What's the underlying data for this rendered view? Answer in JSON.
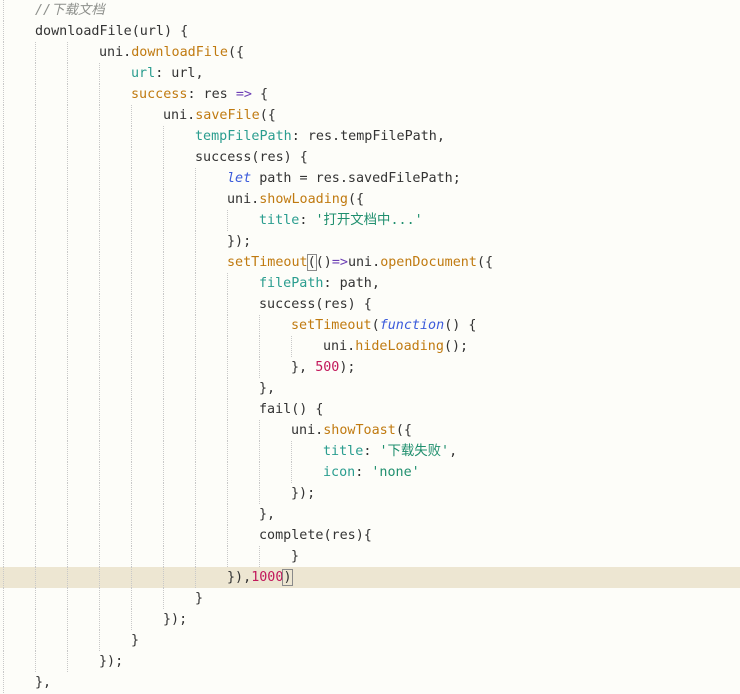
{
  "editor": {
    "current_line_index": 27,
    "lines": [
      {
        "indent": 1,
        "tokens": [
          {
            "t": "//下载文档",
            "c": "comment"
          }
        ]
      },
      {
        "indent": 1,
        "tokens": [
          {
            "t": "downloadFile(url) {",
            "c": ""
          }
        ]
      },
      {
        "indent": 3,
        "tokens": [
          {
            "t": "uni.",
            "c": ""
          },
          {
            "t": "downloadFile",
            "c": "fn"
          },
          {
            "t": "({",
            "c": ""
          }
        ]
      },
      {
        "indent": 4,
        "tokens": [
          {
            "t": "url",
            "c": "prop"
          },
          {
            "t": ": url,",
            "c": ""
          }
        ]
      },
      {
        "indent": 4,
        "tokens": [
          {
            "t": "success",
            "c": "fn"
          },
          {
            "t": ": res ",
            "c": ""
          },
          {
            "t": "=>",
            "c": "op"
          },
          {
            "t": " {",
            "c": ""
          }
        ]
      },
      {
        "indent": 5,
        "tokens": [
          {
            "t": "uni.",
            "c": ""
          },
          {
            "t": "saveFile",
            "c": "fn"
          },
          {
            "t": "({",
            "c": ""
          }
        ]
      },
      {
        "indent": 6,
        "tokens": [
          {
            "t": "tempFilePath",
            "c": "prop"
          },
          {
            "t": ": res.tempFilePath,",
            "c": ""
          }
        ]
      },
      {
        "indent": 6,
        "tokens": [
          {
            "t": "success(res) {",
            "c": ""
          }
        ]
      },
      {
        "indent": 7,
        "tokens": [
          {
            "t": "let",
            "c": "kw"
          },
          {
            "t": " path = res.savedFilePath;",
            "c": ""
          }
        ]
      },
      {
        "indent": 7,
        "tokens": [
          {
            "t": "uni.",
            "c": ""
          },
          {
            "t": "showLoading",
            "c": "fn"
          },
          {
            "t": "({",
            "c": ""
          }
        ]
      },
      {
        "indent": 8,
        "tokens": [
          {
            "t": "title",
            "c": "prop"
          },
          {
            "t": ": ",
            "c": ""
          },
          {
            "t": "'打开文档中...'",
            "c": "str"
          }
        ]
      },
      {
        "indent": 7,
        "tokens": [
          {
            "t": "});",
            "c": ""
          }
        ]
      },
      {
        "indent": 7,
        "tokens": [
          {
            "t": "setTimeout",
            "c": "fn"
          },
          {
            "t": "(",
            "c": "bracket-match"
          },
          {
            "t": "()",
            "c": ""
          },
          {
            "t": "=>",
            "c": "op"
          },
          {
            "t": "uni.",
            "c": ""
          },
          {
            "t": "openDocument",
            "c": "fn"
          },
          {
            "t": "({",
            "c": ""
          }
        ]
      },
      {
        "indent": 8,
        "tokens": [
          {
            "t": "filePath",
            "c": "prop"
          },
          {
            "t": ": path,",
            "c": ""
          }
        ]
      },
      {
        "indent": 8,
        "tokens": [
          {
            "t": "success(res) {",
            "c": ""
          }
        ]
      },
      {
        "indent": 9,
        "tokens": [
          {
            "t": "setTimeout",
            "c": "fn"
          },
          {
            "t": "(",
            "c": ""
          },
          {
            "t": "function",
            "c": "kw"
          },
          {
            "t": "() {",
            "c": ""
          }
        ]
      },
      {
        "indent": 10,
        "tokens": [
          {
            "t": "uni.",
            "c": ""
          },
          {
            "t": "hideLoading",
            "c": "fn"
          },
          {
            "t": "();",
            "c": ""
          }
        ]
      },
      {
        "indent": 9,
        "tokens": [
          {
            "t": "}, ",
            "c": ""
          },
          {
            "t": "500",
            "c": "num"
          },
          {
            "t": ");",
            "c": ""
          }
        ]
      },
      {
        "indent": 8,
        "tokens": [
          {
            "t": "},",
            "c": ""
          }
        ]
      },
      {
        "indent": 8,
        "tokens": [
          {
            "t": "fail() {",
            "c": ""
          }
        ]
      },
      {
        "indent": 9,
        "tokens": [
          {
            "t": "uni.",
            "c": ""
          },
          {
            "t": "showToast",
            "c": "fn"
          },
          {
            "t": "({",
            "c": ""
          }
        ]
      },
      {
        "indent": 10,
        "tokens": [
          {
            "t": "title",
            "c": "prop"
          },
          {
            "t": ": ",
            "c": ""
          },
          {
            "t": "'下载失败'",
            "c": "str"
          },
          {
            "t": ",",
            "c": ""
          }
        ]
      },
      {
        "indent": 10,
        "tokens": [
          {
            "t": "icon",
            "c": "prop"
          },
          {
            "t": ": ",
            "c": ""
          },
          {
            "t": "'none'",
            "c": "str"
          }
        ]
      },
      {
        "indent": 9,
        "tokens": [
          {
            "t": "});",
            "c": ""
          }
        ]
      },
      {
        "indent": 8,
        "tokens": [
          {
            "t": "},",
            "c": ""
          }
        ]
      },
      {
        "indent": 8,
        "tokens": [
          {
            "t": "complete(res){",
            "c": ""
          }
        ]
      },
      {
        "indent": 9,
        "tokens": [
          {
            "t": "}",
            "c": ""
          }
        ]
      },
      {
        "indent": 7,
        "tokens": [
          {
            "t": "}),",
            "c": ""
          },
          {
            "t": "1000",
            "c": "num"
          },
          {
            "t": ")",
            "c": "bracket-match"
          }
        ]
      },
      {
        "indent": 6,
        "tokens": [
          {
            "t": "}",
            "c": ""
          }
        ]
      },
      {
        "indent": 5,
        "tokens": [
          {
            "t": "});",
            "c": ""
          }
        ]
      },
      {
        "indent": 4,
        "tokens": [
          {
            "t": "}",
            "c": ""
          }
        ]
      },
      {
        "indent": 3,
        "tokens": [
          {
            "t": "});",
            "c": ""
          }
        ]
      },
      {
        "indent": 1,
        "tokens": [
          {
            "t": "},",
            "c": ""
          }
        ]
      }
    ]
  }
}
